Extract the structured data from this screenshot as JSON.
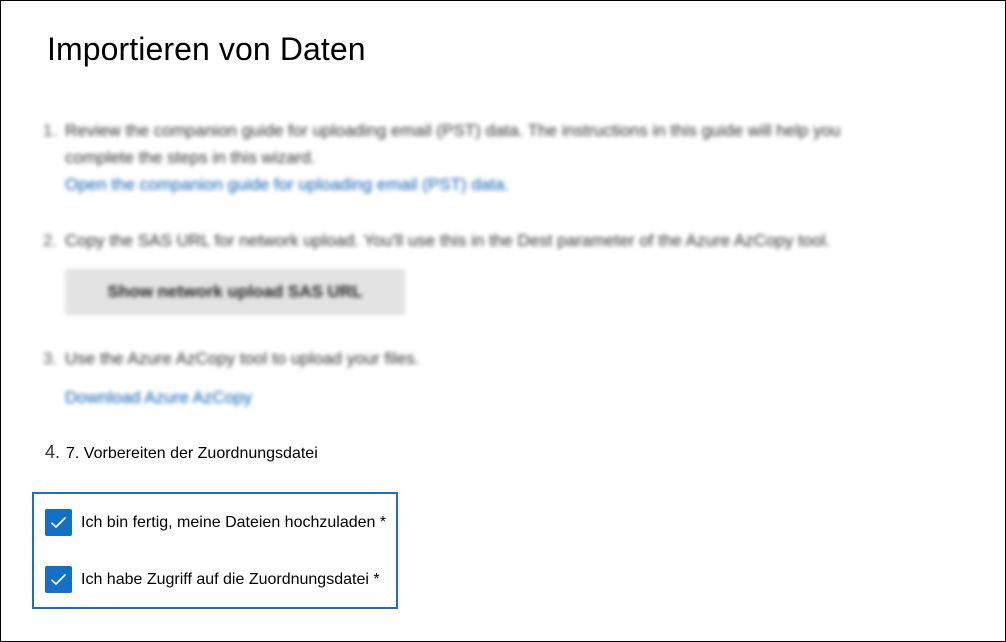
{
  "page": {
    "title": "Importieren von Daten"
  },
  "steps": [
    {
      "number": "1.",
      "text_line1": "Review the companion guide for uploading email (PST) data. The instructions in this guide will help you",
      "text_line2": "complete the steps in this wizard.",
      "link": "Open the companion guide for uploading email (PST) data."
    },
    {
      "number": "2.",
      "text": "Copy the SAS URL for network upload. You'll use this in the Dest parameter of the Azure AzCopy tool.",
      "button_label": "Show network upload SAS URL"
    },
    {
      "number": "3.",
      "text": "Use the Azure AzCopy tool to upload your files.",
      "link": "Download Azure AzCopy"
    },
    {
      "number": "4.",
      "text": "7. Vorbereiten der Zuordnungsdatei"
    }
  ],
  "checkboxes": [
    {
      "label": "Ich bin fertig, meine Dateien hochzuladen *",
      "checked": true
    },
    {
      "label": "Ich habe Zugriff auf die Zuordnungsdatei *",
      "checked": true
    }
  ],
  "colors": {
    "accent": "#1470c4",
    "highlight_border": "#1e6fc0",
    "link": "#0b5fb3"
  },
  "icons": {
    "checkbox": "checkmark-icon"
  }
}
